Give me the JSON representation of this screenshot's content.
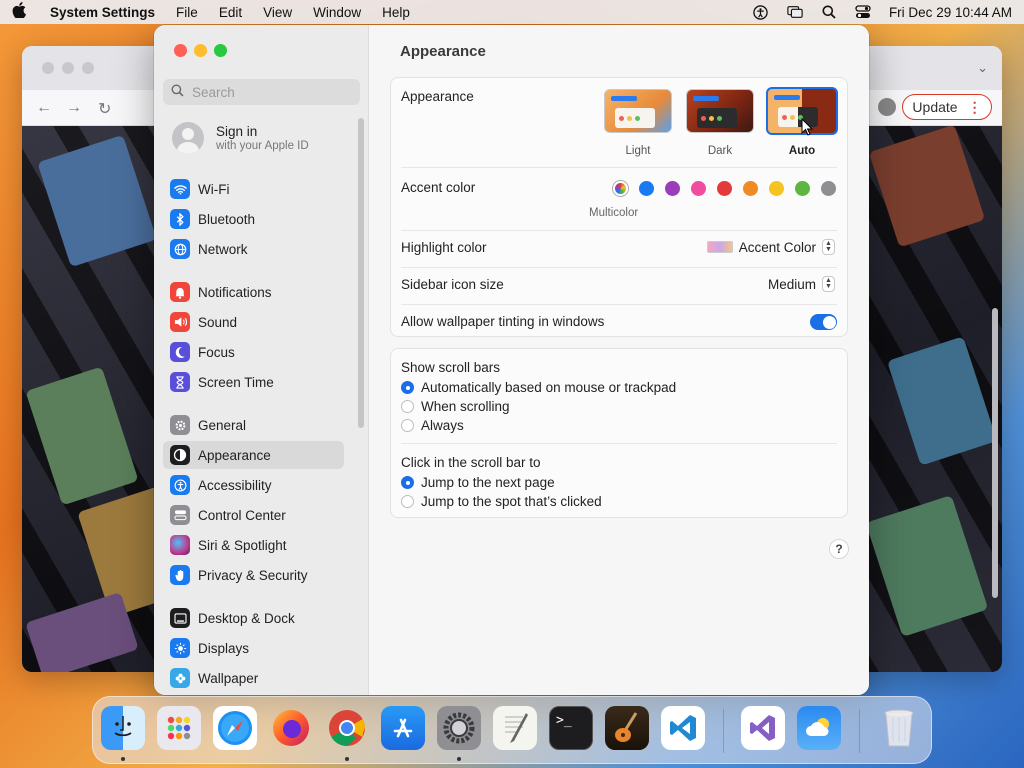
{
  "menubar": {
    "app_name": "System Settings",
    "menus": [
      "File",
      "Edit",
      "View",
      "Window",
      "Help"
    ],
    "clock": "Fri Dec 29  10:44 AM"
  },
  "browser": {
    "update_label": "Update"
  },
  "sidebar": {
    "search_placeholder": "Search",
    "signin_title": "Sign in",
    "signin_subtitle": "with your Apple ID",
    "items": [
      {
        "label": "Wi-Fi",
        "icon": "wifi-icon",
        "color": "#1a7af0"
      },
      {
        "label": "Bluetooth",
        "icon": "bluetooth-icon",
        "color": "#1a7af0"
      },
      {
        "label": "Network",
        "icon": "globe-icon",
        "color": "#1a7af0"
      },
      {
        "label": "Notifications",
        "icon": "bell-icon",
        "color": "#f0453a"
      },
      {
        "label": "Sound",
        "icon": "speaker-icon",
        "color": "#f0453a"
      },
      {
        "label": "Focus",
        "icon": "moon-icon",
        "color": "#5a4fd8"
      },
      {
        "label": "Screen Time",
        "icon": "hourglass-icon",
        "color": "#5a4fd8"
      },
      {
        "label": "General",
        "icon": "gear-icon",
        "color": "#8e8e93"
      },
      {
        "label": "Appearance",
        "icon": "appearance-icon",
        "color": "#1d1d1f"
      },
      {
        "label": "Accessibility",
        "icon": "accessibility-icon",
        "color": "#1a7af0"
      },
      {
        "label": "Control Center",
        "icon": "toggles-icon",
        "color": "#8e8e93"
      },
      {
        "label": "Siri & Spotlight",
        "icon": "siri-icon",
        "color": "#c2378c"
      },
      {
        "label": "Privacy & Security",
        "icon": "hand-icon",
        "color": "#1a7af0"
      },
      {
        "label": "Desktop & Dock",
        "icon": "dock-icon",
        "color": "#1d1d1f"
      },
      {
        "label": "Displays",
        "icon": "sun-icon",
        "color": "#1a7af0"
      },
      {
        "label": "Wallpaper",
        "icon": "flower-icon",
        "color": "#35a8e8"
      }
    ]
  },
  "main": {
    "title": "Appearance",
    "appearance_label": "Appearance",
    "modes": [
      {
        "label": "Light",
        "selected": false
      },
      {
        "label": "Dark",
        "selected": false
      },
      {
        "label": "Auto",
        "selected": true
      }
    ],
    "accent_label": "Accent color",
    "accent_colors": [
      "#ffffff",
      "#1a7af0",
      "#9a3db8",
      "#ef4da0",
      "#e23b3b",
      "#f08a24",
      "#f5c423",
      "#5fb541",
      "#8e8e93"
    ],
    "accent_selected_label": "Multicolor",
    "highlight_label": "Highlight color",
    "highlight_value": "Accent Color",
    "sidebar_icon_label": "Sidebar icon size",
    "sidebar_icon_value": "Medium",
    "tinting_label": "Allow wallpaper tinting in windows",
    "tinting_on": true,
    "scrollbars_label": "Show scroll bars",
    "scrollbar_options": [
      {
        "label": "Automatically based on mouse or trackpad",
        "selected": true
      },
      {
        "label": "When scrolling",
        "selected": false
      },
      {
        "label": "Always",
        "selected": false
      }
    ],
    "click_label": "Click in the scroll bar to",
    "click_options": [
      {
        "label": "Jump to the next page",
        "selected": true
      },
      {
        "label": "Jump to the spot that’s clicked",
        "selected": false
      }
    ],
    "help_label": "?"
  },
  "dock": {
    "apps": [
      "Finder",
      "Launchpad",
      "Safari",
      "Firefox",
      "Chrome",
      "App Store",
      "System Settings",
      "TextEdit",
      "Terminal",
      "GarageBand",
      "VS Code",
      "Visual Studio",
      "Weather",
      "Trash"
    ]
  }
}
